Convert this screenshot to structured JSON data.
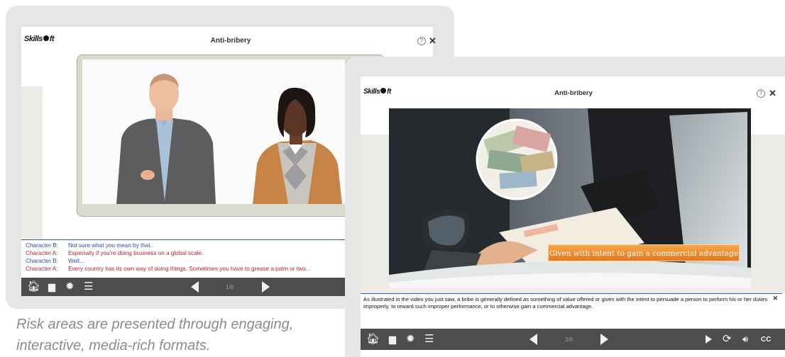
{
  "back_player": {
    "logo": "Skillsoft",
    "title": "Anti-bribery",
    "page": "1/8",
    "transcript": [
      {
        "speaker": "Character B:",
        "text": "Not sure what you mean by that.",
        "color": "#2a4fb0"
      },
      {
        "speaker": "Character A:",
        "text": "Especially if you're doing business on a global scale.",
        "color": "#b8232c"
      },
      {
        "speaker": "Character B:",
        "text": "Well...",
        "color": "#2a4fb0"
      },
      {
        "speaker": "Character A:",
        "text": "Every country has its own way of doing things. Sometimes you have to grease a palm or two...",
        "color": "#b8232c"
      }
    ]
  },
  "front_player": {
    "logo": "Skillsoft",
    "title": "Anti-bribery",
    "page": "3/8",
    "banner": "Given with intent to gain a commercial advantage",
    "caption": "As illustrated in the video you just saw, a bribe is generally defined as something of value offered or given with the intent to persuade a person to perform his or her duties improperly, to reward such improper performance, or to otherwise gain a commercial advantage.",
    "cc_label": "CC"
  },
  "caption_text": "Risk areas are presented through engaging, interactive, media-rich formats.",
  "colors": {
    "toolbar": "#4c4d4c",
    "banner": "#e98a2c",
    "transcript_blue": "#2a4fb0",
    "transcript_red": "#b8232c"
  }
}
